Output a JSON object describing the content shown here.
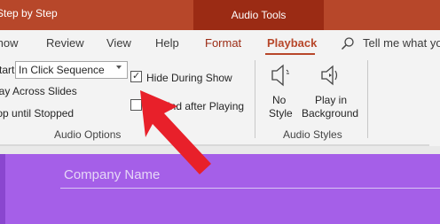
{
  "window": {
    "title": "Step by Step",
    "contextual_tab": "Audio Tools"
  },
  "tabs": [
    {
      "label": "Show"
    },
    {
      "label": "Review"
    },
    {
      "label": "View"
    },
    {
      "label": "Help"
    },
    {
      "label": "Format"
    },
    {
      "label": "Playback"
    }
  ],
  "tellme": {
    "text": "Tell me what you"
  },
  "audio_options": {
    "start_label": "Start:",
    "start_value": "In Click Sequence",
    "play_across_slides": "Play Across Slides",
    "loop_until_stopped": "Loop until Stopped",
    "hide_during_show": "Hide During Show",
    "hide_during_show_checked": true,
    "rewind_after_playing": "Rewind after Playing",
    "rewind_checked": false,
    "group_label": "Audio Options"
  },
  "audio_styles": {
    "no_style_line1": "No",
    "no_style_line2": "Style",
    "play_bg_line1": "Play in",
    "play_bg_line2": "Background",
    "group_label": "Audio Styles"
  },
  "slide": {
    "placeholder": "Company Name"
  },
  "colors": {
    "title_bar": "#b7472a",
    "contextual_tab": "#9b2b14",
    "slide_bg": "#a55fe8",
    "annotation_arrow": "#e8202a"
  }
}
